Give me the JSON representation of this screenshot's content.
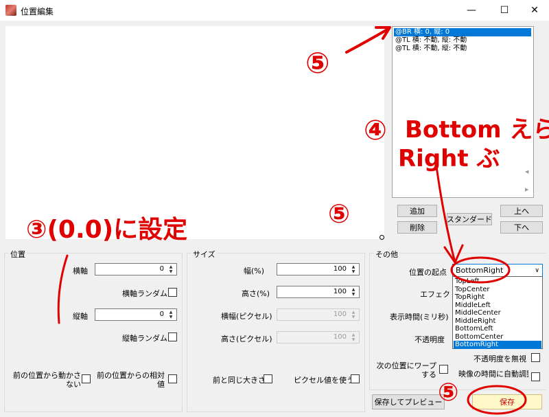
{
  "window": {
    "title": "位置編集",
    "min_glyph": "—",
    "max_glyph": "☐",
    "close_glyph": "✕"
  },
  "position_list": {
    "items": [
      "@BR 横: 0, 縦: 0",
      "@TL 横: 不動, 縦: 不動",
      "@TL 横: 不動, 縦: 不動"
    ],
    "selected_index": 0
  },
  "list_buttons": {
    "add": "追加",
    "delete": "削除",
    "standard": "スタンダード",
    "up": "上へ",
    "down": "下へ"
  },
  "position_group": {
    "title": "位置",
    "x_label": "横軸",
    "x_value": "0",
    "x_random_label": "横軸ランダム",
    "y_label": "縦軸",
    "y_value": "0",
    "y_random_label": "縦軸ランダム",
    "no_move_label": "前の位置から動かさない",
    "relative_label": "前の位置からの相対値"
  },
  "size_group": {
    "title": "サイズ",
    "width_pct_label": "幅(%)",
    "width_pct_value": "100",
    "height_pct_label": "高さ(%)",
    "height_pct_value": "100",
    "width_px_label": "横幅(ピクセル)",
    "width_px_value": "100",
    "height_px_label": "高さ(ピクセル)",
    "height_px_value": "100",
    "same_size_label": "前と同じ大きさ",
    "use_pixel_label": "ピクセル値を使う"
  },
  "other_group": {
    "title": "その他",
    "origin_label": "位置の起点",
    "origin_value": "BottomRight",
    "effect_label": "エフェクト",
    "display_time_label": "表示時間(ミリ秒)",
    "opacity_label": "不透明度",
    "ignore_opacity_label": "不透明度を無視",
    "warp_label": "次の位置にワープする",
    "auto_adjust_label": "映像の時間に自動調整",
    "origin_options": [
      "TopLeft",
      "TopCenter",
      "TopRight",
      "MiddleLeft",
      "MiddleCenter",
      "MiddleRight",
      "BottomLeft",
      "BottomCenter",
      "BottomRight"
    ],
    "origin_selected_index": 8
  },
  "footer": {
    "save_preview": "保存してプレビュー",
    "save": "保存"
  },
  "annotations": {
    "step5_top": "⑤",
    "step4": "④",
    "bottomright_note_1": "Bottom えら",
    "bottomright_note_2": "Right ぶ",
    "step3_note": "③(0.0)に設定",
    "step5_mid": "⑤",
    "step5_bottom": "⑤"
  },
  "colors": {
    "annotation_red": "#e00000",
    "selection_blue": "#0078d7",
    "save_button_bg": "#fff8c8"
  }
}
